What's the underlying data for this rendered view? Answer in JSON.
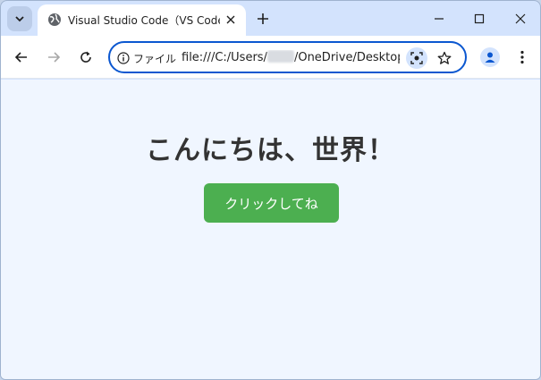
{
  "tab": {
    "title": "Visual Studio Code（VS Code）"
  },
  "address_bar": {
    "site_info_label": "ファイル",
    "url_prefix": "file:///C:/Users/",
    "url_suffix": "/OneDrive/Desktop"
  },
  "page": {
    "heading": "こんにちは、世界！",
    "button_label": "クリックしてね"
  },
  "colors": {
    "accent": "#0b57d0",
    "button": "#4caf50",
    "page_background": "#f0f6ff",
    "chrome_frame": "#d3e3fd"
  }
}
